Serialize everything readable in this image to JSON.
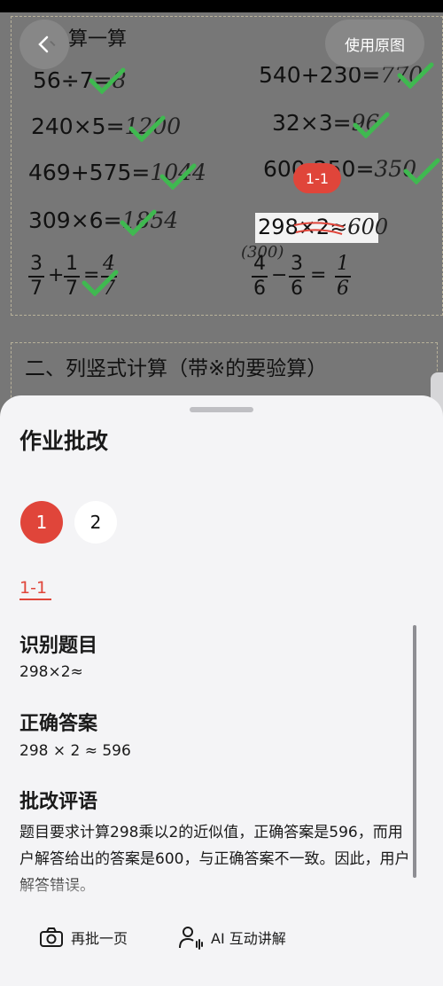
{
  "header": {
    "back_icon": "chevron-left-icon",
    "use_original_label": "使用原图",
    "question_marker": "1-1"
  },
  "worksheet": {
    "section1_title": "、算一算",
    "section2_title": "二、列竖式计算（带※的要验算）",
    "problems": [
      {
        "printed": "56÷7=",
        "written": "8"
      },
      {
        "printed": "540+230=",
        "written": "770"
      },
      {
        "printed": "240×5=",
        "written": "1200"
      },
      {
        "printed": "32×3=",
        "written": "96"
      },
      {
        "printed": "469+575=",
        "written": "1044"
      },
      {
        "printed": "600-250=",
        "written": "350"
      },
      {
        "printed": "309×6=",
        "written": "1854"
      },
      {
        "printed": "298×2≈",
        "written": "600"
      }
    ],
    "note_written": "(300)",
    "fractions": {
      "left": {
        "a_num": "3",
        "a_den": "7",
        "op": "+",
        "b_num": "1",
        "b_den": "7",
        "eq": "=",
        "ans_num": "4",
        "ans_den": "7"
      },
      "right": {
        "a_num": "4",
        "a_den": "6",
        "op": "−",
        "b_num": "3",
        "b_den": "6",
        "eq": "=",
        "ans_num": "1",
        "ans_den": "6"
      }
    },
    "check_color": "#3fb950"
  },
  "panel": {
    "title": "作业批改",
    "tabs": [
      "1",
      "2"
    ],
    "active_tab": "1",
    "subtab": "1-1",
    "recognize_heading": "识别题目",
    "recognize_text": "298×2≈",
    "answer_heading": "正确答案",
    "answer_text": "298 × 2 ≈ 596",
    "comment_heading": "批改评语",
    "comment_text": "题目要求计算298乘以2的近似值，正确答案是596，而用户解答给出的答案是600，与正确答案不一致。因此，用户解答错误。"
  },
  "actions": {
    "recheck_label": "再批一页",
    "recheck_icon": "camera-icon",
    "ai_label": "AI 互动讲解",
    "ai_icon": "person-voice-icon"
  },
  "colors": {
    "accent": "#e0453a",
    "check": "#3fb950"
  }
}
